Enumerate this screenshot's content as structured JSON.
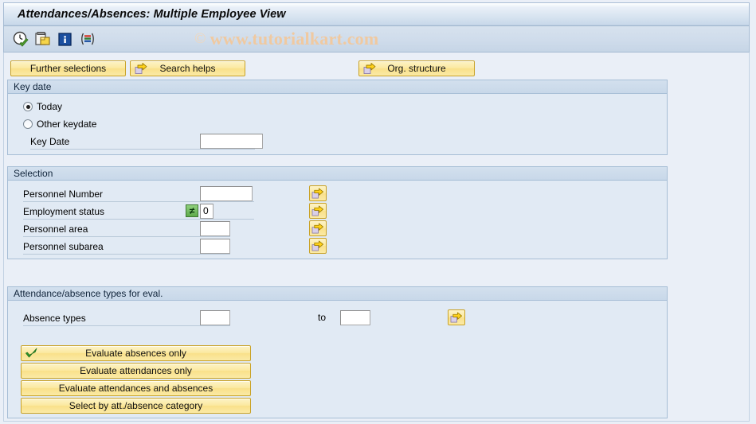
{
  "window": {
    "title": "Attendances/Absences: Multiple Employee View"
  },
  "watermark": {
    "copyright": "©",
    "text": "www.tutorialkart.com",
    "color": "#f0c9a0"
  },
  "toolbar": {
    "icons": [
      {
        "name": "execute-clock-icon",
        "label": "Execute"
      },
      {
        "name": "copy-variant-icon",
        "label": "Get Variant"
      },
      {
        "name": "info-icon",
        "label": "Information"
      },
      {
        "name": "color-bars-icon",
        "label": "Display Layout"
      }
    ]
  },
  "action_buttons": [
    {
      "name": "further-selections-button",
      "label": "Further selections",
      "icon": null
    },
    {
      "name": "search-helps-button",
      "label": "Search helps",
      "icon": "arrow-right-icon"
    },
    {
      "name": "org-structure-button",
      "label": "Org. structure",
      "icon": "arrow-right-icon"
    }
  ],
  "key_date": {
    "title": "Key date",
    "options": [
      {
        "name": "radio-today",
        "label": "Today",
        "selected": true
      },
      {
        "name": "radio-other-keydate",
        "label": "Other keydate",
        "selected": false
      }
    ],
    "field": {
      "label": "Key Date",
      "value": "",
      "placeholder": ""
    }
  },
  "selection": {
    "title": "Selection",
    "rows": [
      {
        "name": "personnel-number",
        "label": "Personnel Number",
        "value": "",
        "operator": null,
        "has_multi": true
      },
      {
        "name": "employment-status",
        "label": "Employment status",
        "value": "0",
        "operator": "≠",
        "has_multi": true
      },
      {
        "name": "personnel-area",
        "label": "Personnel area",
        "value": "",
        "operator": null,
        "has_multi": true
      },
      {
        "name": "personnel-subarea",
        "label": "Personnel subarea",
        "value": "",
        "operator": null,
        "has_multi": true
      }
    ]
  },
  "att_abs_types": {
    "title": "Attendance/absence types for eval.",
    "row": {
      "name": "absence-types",
      "label": "Absence types",
      "from_value": "",
      "to_label": "to",
      "to_value": ""
    }
  },
  "evaluate_buttons": [
    {
      "name": "evaluate-absences-only-button",
      "label": "Evaluate absences only",
      "checked": true
    },
    {
      "name": "evaluate-attendances-only-button",
      "label": "Evaluate attendances only",
      "checked": false
    },
    {
      "name": "evaluate-attendances-and-absences-button",
      "label": "Evaluate attendances and absences",
      "checked": false
    },
    {
      "name": "select-by-category-button",
      "label": "Select by att./absence category",
      "checked": false
    }
  ],
  "colors": {
    "title_bar": "#c9d9ea",
    "toolbar": "#cfdceb",
    "canvas": "#eaeff7",
    "group_head": "#c8d8e9",
    "group_body": "#e1eaf4",
    "button_yellow": "#fbe9a0",
    "button_border": "#c9a227",
    "operator_green": "#5faa4b"
  }
}
